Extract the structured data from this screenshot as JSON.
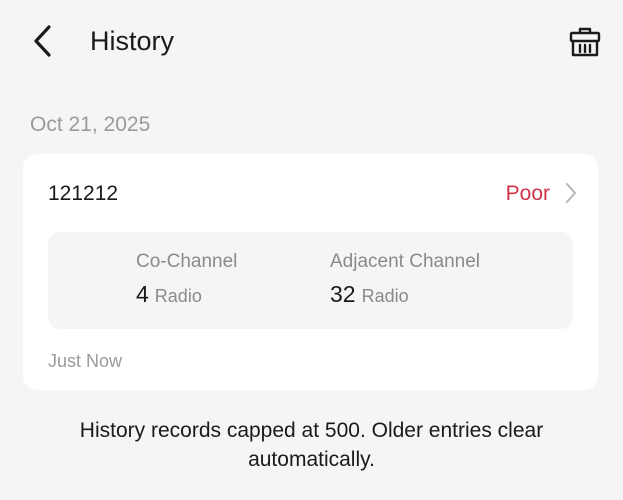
{
  "header": {
    "title": "History",
    "back_icon": "chevron-left-icon",
    "delete_icon": "trash-basket-icon"
  },
  "groups": [
    {
      "date": "Oct 21, 2025",
      "records": [
        {
          "name": "121212",
          "status": "Poor",
          "status_color": "#d1334a",
          "co_channel": {
            "label": "Co-Channel",
            "value": "4",
            "unit": "Radio"
          },
          "adjacent_channel": {
            "label": "Adjacent Channel",
            "value": "32",
            "unit": "Radio"
          },
          "time": "Just Now"
        }
      ]
    }
  ],
  "footer": {
    "note": "History records capped at 500. Older entries clear automatically."
  }
}
